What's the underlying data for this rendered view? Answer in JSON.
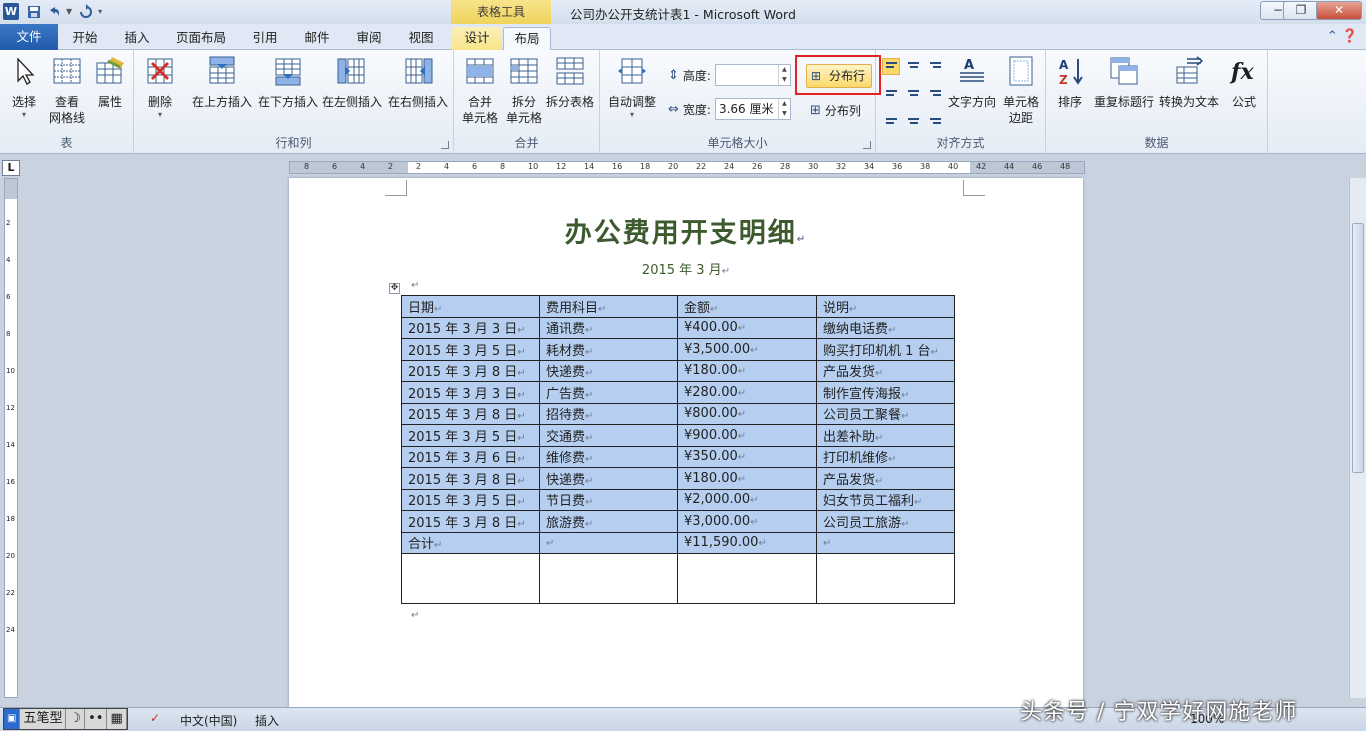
{
  "window": {
    "app_logo": "W",
    "title": "公司办公开支统计表1 - Microsoft Word",
    "context_tab_group": "表格工具",
    "buttons": {
      "minimize": "−",
      "restore": "❐",
      "close": "✕"
    }
  },
  "tabs": {
    "file": "文件",
    "items": [
      "开始",
      "插入",
      "页面布局",
      "引用",
      "邮件",
      "审阅",
      "视图"
    ],
    "design": "设计",
    "layout": "布局"
  },
  "ribbon": {
    "groups": {
      "table": "表",
      "rows_cols": "行和列",
      "merge": "合并",
      "cell_size": "单元格大小",
      "alignment": "对齐方式",
      "data": "数据"
    },
    "table_group": {
      "select": "选择",
      "gridlines_1": "查看",
      "gridlines_2": "网格线",
      "properties": "属性"
    },
    "rows_cols_group": {
      "delete": "删除",
      "insert_above": "在上方插入",
      "insert_below": "在下方插入",
      "insert_left": "在左侧插入",
      "insert_right": "在右侧插入"
    },
    "merge_group": {
      "merge_1": "合并",
      "merge_2": "单元格",
      "split_1": "拆分",
      "split_2": "单元格",
      "split_table": "拆分表格"
    },
    "cell_size_group": {
      "autofit": "自动调整",
      "height_label": "高度:",
      "height_value": "",
      "width_label": "宽度:",
      "width_value": "3.66 厘米",
      "distribute_rows": "分布行",
      "distribute_cols": "分布列"
    },
    "alignment_group": {
      "text_direction": "文字方向",
      "cell_margins_1": "单元格",
      "cell_margins_2": "边距"
    },
    "data_group": {
      "sort": "排序",
      "repeat_header": "重复标题行",
      "convert_text": "转换为文本",
      "formula": "公式"
    }
  },
  "ruler": {
    "corner": "L",
    "ticks": [
      "8",
      "6",
      "4",
      "2",
      "2",
      "4",
      "6",
      "8",
      "10",
      "12",
      "14",
      "16",
      "18",
      "20",
      "22",
      "24",
      "26",
      "28",
      "30",
      "32",
      "34",
      "36",
      "38",
      "40",
      "42",
      "44",
      "46",
      "48"
    ],
    "vertical_ticks": [
      "2",
      "4",
      "6",
      "8",
      "10",
      "12",
      "14",
      "16",
      "18",
      "20",
      "22",
      "24"
    ]
  },
  "document": {
    "heading": "办公费用开支明细",
    "date": "2015 年 3 月",
    "para_mark": "↵",
    "table": {
      "header": [
        "日期",
        "费用科目",
        "金额",
        "说明"
      ],
      "rows": [
        [
          "2015 年 3 月 3 日",
          "通讯费",
          "¥400.00",
          "缴纳电话费"
        ],
        [
          "2015 年 3 月 5 日",
          "耗材费",
          "¥3,500.00",
          "购买打印机机 1 台"
        ],
        [
          "2015 年 3 月 8 日",
          "快递费",
          "¥180.00",
          "产品发货"
        ],
        [
          "2015 年 3 月 3 日",
          "广告费",
          "¥280.00",
          "制作宣传海报"
        ],
        [
          "2015 年 3 月 8 日",
          "招待费",
          "¥800.00",
          "公司员工聚餐"
        ],
        [
          "2015 年 3 月 5 日",
          "交通费",
          "¥900.00",
          "出差补助"
        ],
        [
          "2015 年 3 月 6 日",
          "维修费",
          "¥350.00",
          "打印机维修"
        ],
        [
          "2015 年 3 月 8 日",
          "快递费",
          "¥180.00",
          "产品发货"
        ],
        [
          "2015 年 3 月 5 日",
          "节日费",
          "¥2,000.00",
          "妇女节员工福利"
        ],
        [
          "2015 年 3 月 8 日",
          "旅游费",
          "¥3,000.00",
          "公司员工旅游"
        ]
      ],
      "total": [
        "合计",
        "",
        "¥11,590.00",
        ""
      ]
    }
  },
  "statusbar": {
    "ime": [
      "五笔型",
      "☽",
      "••",
      "▦"
    ],
    "language": "中文(中国)",
    "mode": "插入",
    "zoom": "100%"
  },
  "watermark": "头条号 / 宁双学好网施老师",
  "colors": {
    "selection": "#b6cff0",
    "heading": "#3d5a2e",
    "context_tab": "#f7e48a",
    "file_tab": "#2a62b0",
    "highlight_box": "#e52222"
  }
}
